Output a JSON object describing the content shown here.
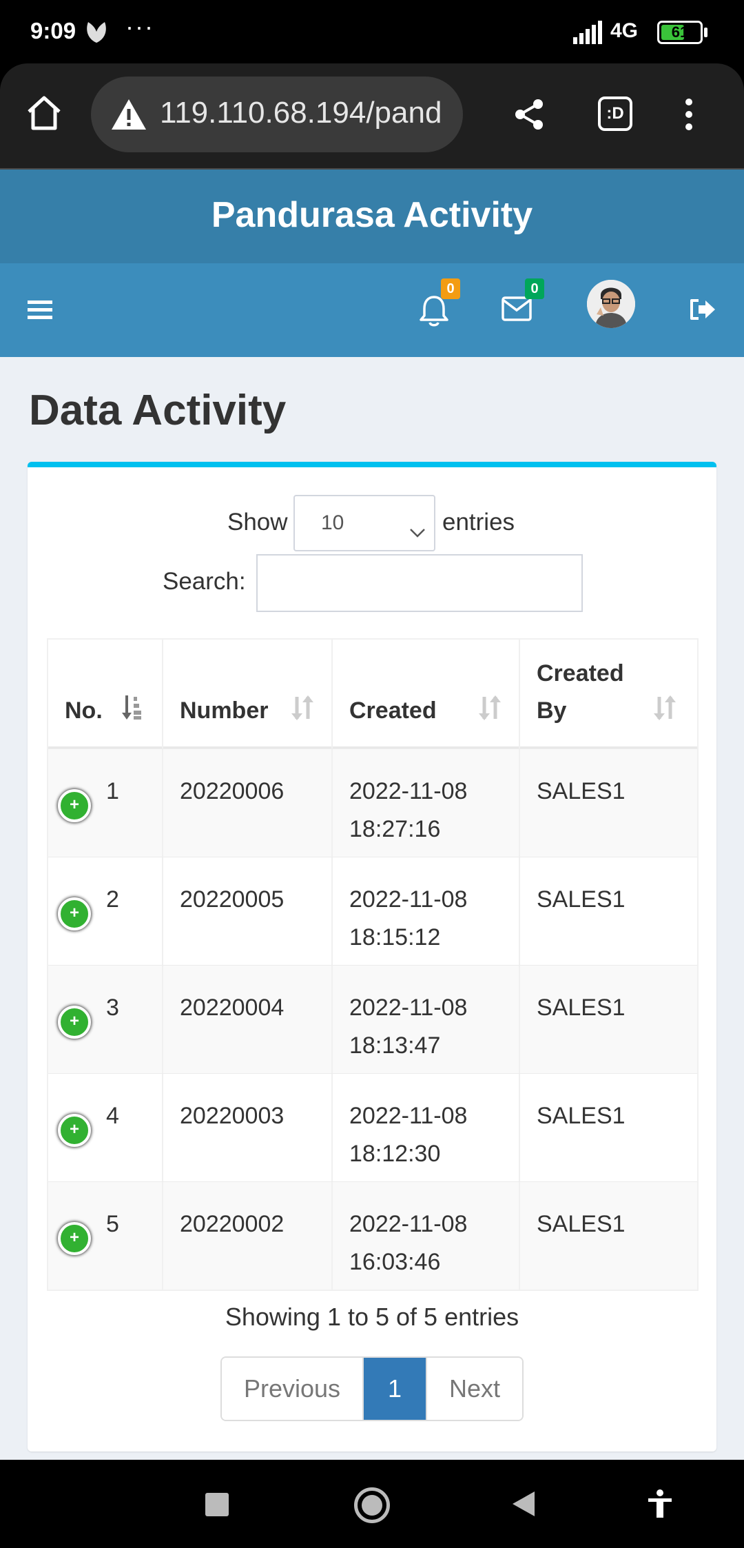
{
  "status_bar": {
    "time": "9:09",
    "dots": "···",
    "network": "4G",
    "battery": "61",
    "battery_level": 0.61
  },
  "browser": {
    "url": "119.110.68.194/pand"
  },
  "app": {
    "title": "Pandurasa Activity",
    "notifications_count": "0",
    "messages_count": "0"
  },
  "page": {
    "title": "Data Activity"
  },
  "controls": {
    "show_label": "Show",
    "show_value": "10",
    "entries_label": "entries",
    "search_label": "Search:",
    "search_value": ""
  },
  "table": {
    "headers": [
      "No.",
      "Number",
      "Created",
      "Created By"
    ],
    "rows": [
      {
        "no": "1",
        "number": "20220006",
        "created_date": "2022-11-08",
        "created_time": "18:27:16",
        "created_by": "SALES1"
      },
      {
        "no": "2",
        "number": "20220005",
        "created_date": "2022-11-08",
        "created_time": "18:15:12",
        "created_by": "SALES1"
      },
      {
        "no": "3",
        "number": "20220004",
        "created_date": "2022-11-08",
        "created_time": "18:13:47",
        "created_by": "SALES1"
      },
      {
        "no": "4",
        "number": "20220003",
        "created_date": "2022-11-08",
        "created_time": "18:12:30",
        "created_by": "SALES1"
      },
      {
        "no": "5",
        "number": "20220002",
        "created_date": "2022-11-08",
        "created_time": "16:03:46",
        "created_by": "SALES1"
      }
    ],
    "expand_glyph": "+"
  },
  "pagination": {
    "info": "Showing 1 to 5 of 5 entries",
    "previous": "Previous",
    "current": "1",
    "next": "Next"
  },
  "colors": {
    "header_dark": "#367fa9",
    "header": "#3c8dbc",
    "box_accent": "#00c0ef",
    "page_active": "#337ab7",
    "expand_button": "#31b131",
    "badge_bell": "#f39c12",
    "badge_mail": "#00a65a"
  }
}
